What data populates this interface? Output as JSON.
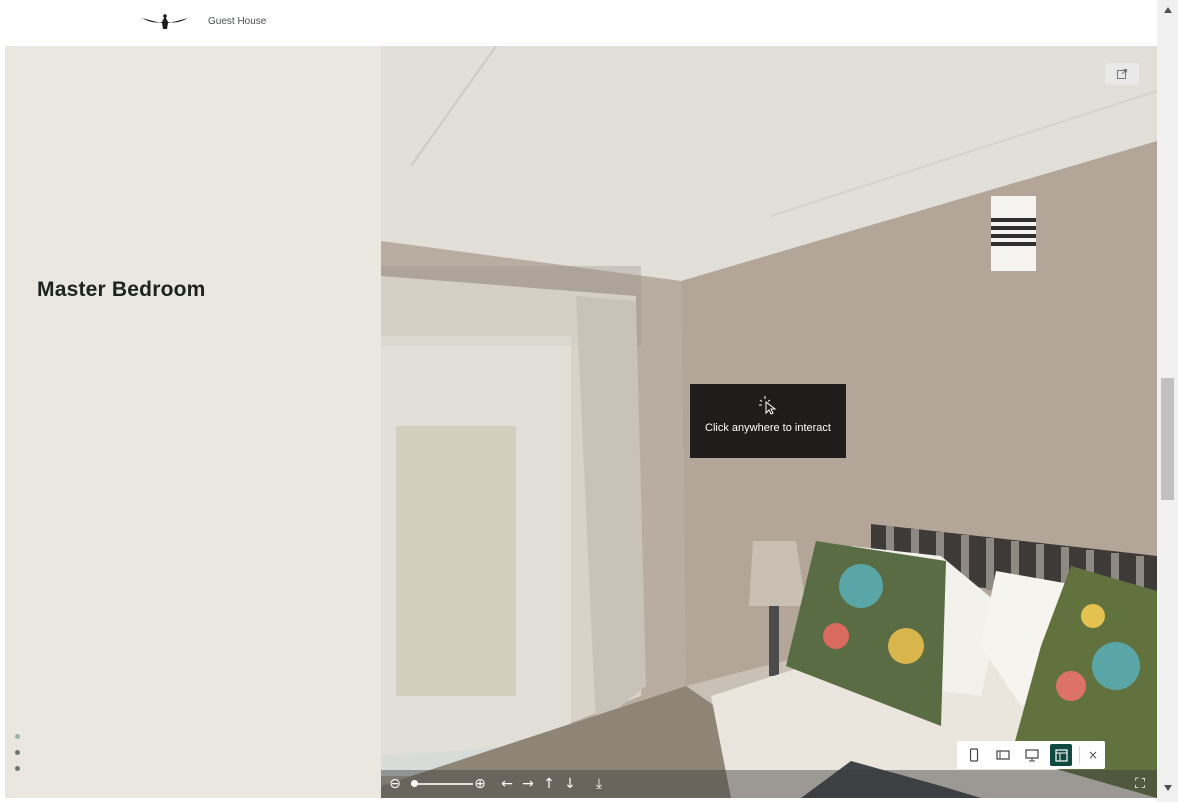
{
  "header": {
    "brand_name": "Guest House",
    "logo_icon": "bird-logo-icon"
  },
  "left_panel": {
    "section_title": "Master Bedroom",
    "pagination_dots": 3,
    "active_dot": 0
  },
  "viewer": {
    "overlay_message": "Click anywhere to interact",
    "external_link_icon": "external-link-icon",
    "device_buttons": [
      {
        "name": "mobile-view-button",
        "icon": "phone-icon",
        "active": false
      },
      {
        "name": "tablet-view-button",
        "icon": "tablet-icon",
        "active": false
      },
      {
        "name": "desktop-view-button",
        "icon": "monitor-icon",
        "active": false
      },
      {
        "name": "split-view-button",
        "icon": "layout-icon",
        "active": true
      }
    ],
    "close_label": "×",
    "toolbar": {
      "icons": [
        "zoom-out-icon",
        "zoom-in-icon",
        "arrow-left-icon",
        "arrow-right-icon",
        "arrow-up-icon",
        "arrow-down-icon",
        "download-icon",
        "fullscreen-icon"
      ],
      "glyphs": {
        "zoom_out": "⊖",
        "zoom_in": "⊕",
        "left": "←",
        "right": "→",
        "up": "↑",
        "down": "↓",
        "download": "⤓",
        "fullscreen": "⛶"
      }
    }
  },
  "colors": {
    "panel_bg": "#e9e7e0",
    "accent": "#0f4940",
    "title_text": "#1d2321"
  }
}
